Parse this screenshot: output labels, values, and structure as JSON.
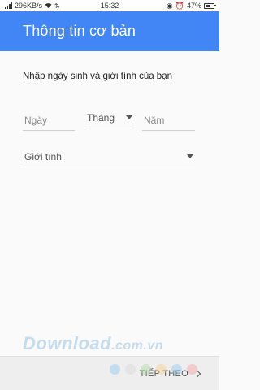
{
  "status_bar": {
    "network_speed": "296KB/s",
    "time": "15:32",
    "battery": "47%"
  },
  "app_bar": {
    "title": "Thông tin cơ bản"
  },
  "form": {
    "prompt": "Nhập ngày sinh và giới tính của bạn",
    "day_placeholder": "Ngày",
    "month_label": "Tháng",
    "year_placeholder": "Năm",
    "gender_label": "Giới tính"
  },
  "footer": {
    "next_label": "TIẾP THEO"
  },
  "watermark": {
    "brand": "Download",
    "tld": ".com.vn",
    "dot_colors": [
      "#8ec7ea",
      "#d6d6d6",
      "#a8d8a0",
      "#f5d08a",
      "#8ec7ea",
      "#f4a0a0"
    ]
  },
  "colors": {
    "primary": "#4285f4"
  }
}
